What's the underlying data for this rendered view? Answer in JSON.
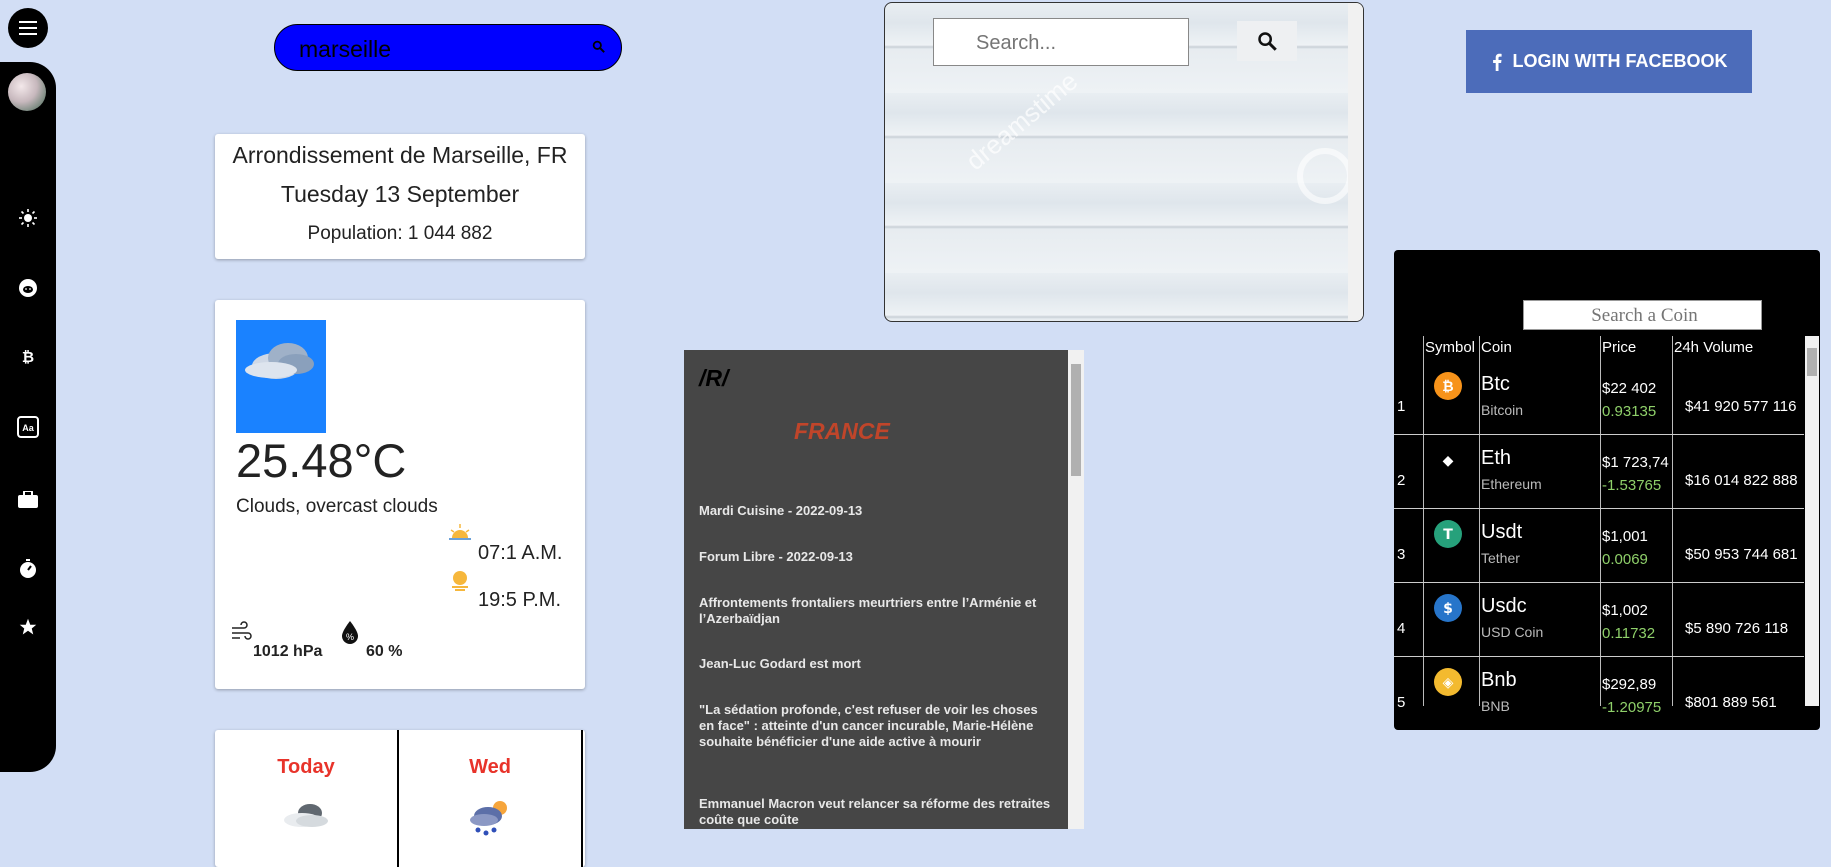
{
  "sidebar": {
    "items": [
      {
        "icon": "sun-icon"
      },
      {
        "icon": "reddit-icon"
      },
      {
        "icon": "bitcoin-icon"
      },
      {
        "icon": "translate-icon"
      },
      {
        "icon": "briefcase-icon"
      },
      {
        "icon": "stopwatch-icon"
      },
      {
        "icon": "star-icon"
      }
    ]
  },
  "city_search": {
    "value": "marseille"
  },
  "location": {
    "city": "Arrondissement de Marseille, FR",
    "date": "Tuesday 13 September",
    "population": "Population: 1 044 882"
  },
  "weather": {
    "temperature": "25.48°C",
    "description": "Clouds, overcast clouds",
    "sunrise": "07:1 A.M.",
    "sunset": "19:5 P.M.",
    "pressure": "1012 hPa",
    "humidity": "60 %"
  },
  "forecast": [
    {
      "day": "Today",
      "icon": "cloud-icon"
    },
    {
      "day": "Wed",
      "icon": "rain-sun-icon"
    }
  ],
  "reddit": {
    "title": "/R/",
    "subreddit": "FRANCE",
    "posts": [
      "Mardi Cuisine - 2022-09-13",
      "Forum Libre - 2022-09-13",
      "Affrontements frontaliers meurtriers entre l’Arménie et l’Azerbaïdjan",
      "Jean-Luc Godard est mort",
      "\"La sédation profonde, c'est refuser de voir les choses en face\" : atteinte d'un cancer incurable, Marie-Hélène souhaite bénéficier d'une aide active à mourir",
      "Emmanuel Macron veut relancer sa réforme des retraites coûte que coûte"
    ]
  },
  "image_search": {
    "placeholder": "Search...",
    "watermark": "dreamstime"
  },
  "facebook": {
    "label": "LOGIN WITH FACEBOOK"
  },
  "crypto": {
    "search_placeholder": "Search a Coin",
    "headers": {
      "symbol": "Symbol",
      "coin": "Coin",
      "price": "Price",
      "volume": "24h Volume"
    },
    "coins": [
      {
        "rank": "1",
        "symbol": "Btc",
        "name": "Bitcoin",
        "price": "$22 402",
        "change": "0.93135",
        "volume": "$41 920 577 116",
        "color": "#f7931a",
        "glyph": "₿"
      },
      {
        "rank": "2",
        "symbol": "Eth",
        "name": "Ethereum",
        "price": "$1 723,74",
        "change": "-1.53765",
        "volume": "$16 014 822 888",
        "color": "#000000",
        "glyph": "◆"
      },
      {
        "rank": "3",
        "symbol": "Usdt",
        "name": "Tether",
        "price": "$1,001",
        "change": "0.0069",
        "volume": "$50 953 744 681",
        "color": "#26a17b",
        "glyph": "T"
      },
      {
        "rank": "4",
        "symbol": "Usdc",
        "name": "USD Coin",
        "price": "$1,002",
        "change": "0.11732",
        "volume": "$5 890 726 118",
        "color": "#2775ca",
        "glyph": "$"
      },
      {
        "rank": "5",
        "symbol": "Bnb",
        "name": "BNB",
        "price": "$292,89",
        "change": "-1.20975",
        "volume": "$801 889 561",
        "color": "#f3ba2f",
        "glyph": "◈"
      }
    ]
  }
}
